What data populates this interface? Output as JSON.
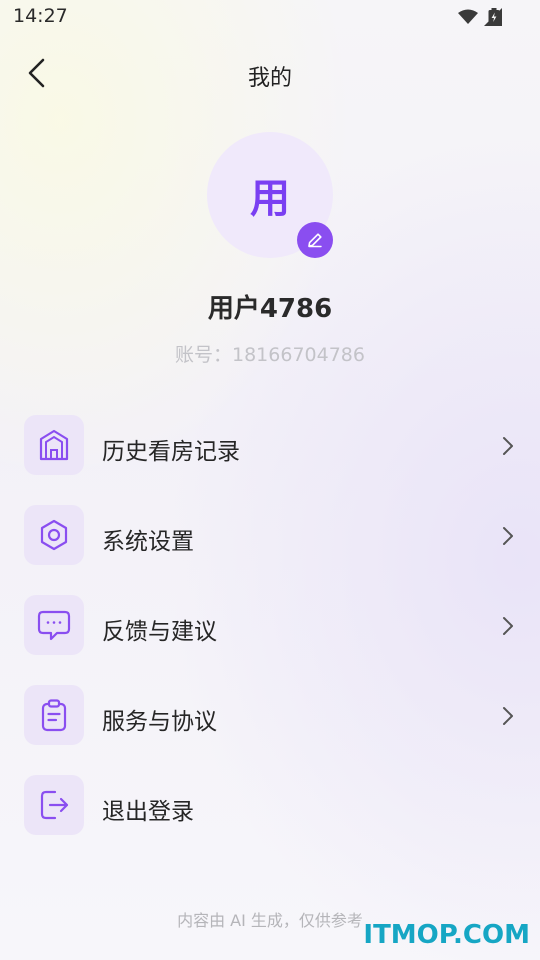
{
  "status_bar": {
    "time": "14:27"
  },
  "header": {
    "title": "我的"
  },
  "profile": {
    "avatar_char": "用",
    "username": "用户4786",
    "account": "账号：18166704786"
  },
  "menu": [
    {
      "label": "历史看房记录",
      "icon": "house-icon",
      "chevron": true
    },
    {
      "label": "系统设置",
      "icon": "hexagon-settings-icon",
      "chevron": true
    },
    {
      "label": "反馈与建议",
      "icon": "chat-bubble-icon",
      "chevron": true
    },
    {
      "label": "服务与协议",
      "icon": "clipboard-icon",
      "chevron": true
    },
    {
      "label": "退出登录",
      "icon": "logout-icon",
      "chevron": false
    }
  ],
  "footer": {
    "note": "内容由 AI 生成，仅供参考"
  },
  "watermark": {
    "text": "ITMOP.COM"
  },
  "colors": {
    "accent": "#8a4ef0",
    "icon_bg": "#ece5f8",
    "avatar_bg": "#f0e9fb"
  }
}
